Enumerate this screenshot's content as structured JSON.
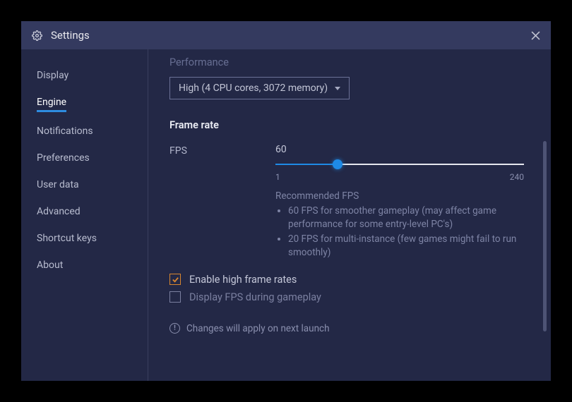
{
  "window": {
    "title": "Settings"
  },
  "sidebar": {
    "items": [
      {
        "label": "Display"
      },
      {
        "label": "Engine"
      },
      {
        "label": "Notifications"
      },
      {
        "label": "Preferences"
      },
      {
        "label": "User data"
      },
      {
        "label": "Advanced"
      },
      {
        "label": "Shortcut keys"
      },
      {
        "label": "About"
      }
    ],
    "active_index": 1
  },
  "content": {
    "performance": {
      "label": "Performance",
      "selected": "High (4 CPU cores, 3072 memory)"
    },
    "frame_rate": {
      "title": "Frame rate",
      "fps_label": "FPS",
      "value": "60",
      "min": "1",
      "max": "240",
      "recommended_label": "Recommended FPS",
      "recommendations": [
        "60 FPS for smoother gameplay (may affect game performance for some entry-level PC's)",
        "20 FPS for multi-instance (few games might fail to run smoothly)"
      ]
    },
    "checks": {
      "high_frame": {
        "label": "Enable high frame rates",
        "checked": true
      },
      "display_fps": {
        "label": "Display FPS during gameplay",
        "checked": false
      }
    },
    "notice": "Changes will apply on next launch"
  }
}
